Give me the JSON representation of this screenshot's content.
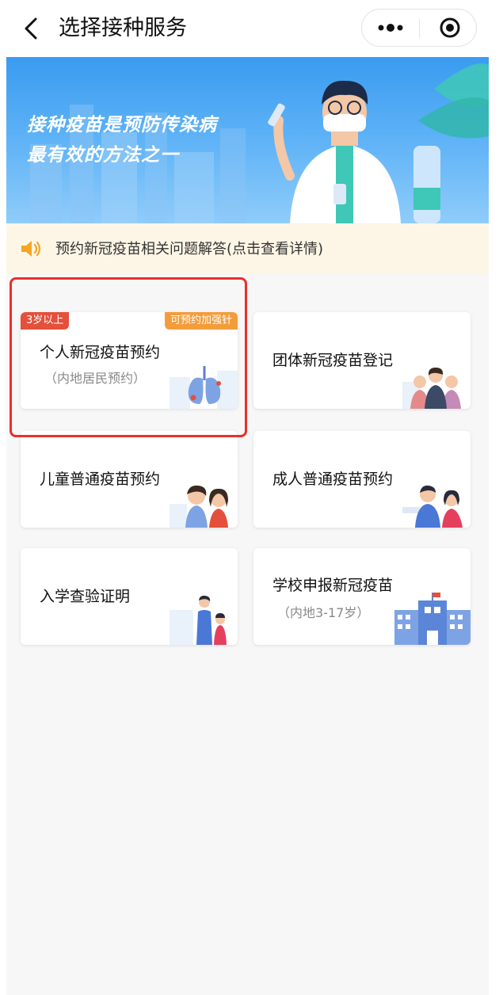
{
  "nav": {
    "title": "选择接种服务",
    "back_icon": "chevron-left-icon",
    "more_icon": "more-dots-icon",
    "close_icon": "target-close-icon"
  },
  "banner": {
    "line1": "接种疫苗是预防传染病",
    "line2": "最有效的方法之一"
  },
  "notice": {
    "icon": "speaker-icon",
    "text": "预约新冠疫苗相关问题解答(点击查看详情)"
  },
  "cards": [
    {
      "title": "个人新冠疫苗预约",
      "subtitle": "（内地居民预约）",
      "badge_left": "3岁以上",
      "badge_right": "可预约加强针",
      "illustration": "lungs-icon"
    },
    {
      "title": "团体新冠疫苗登记",
      "illustration": "group-people-icon"
    },
    {
      "title": "儿童普通疫苗预约",
      "illustration": "children-icon"
    },
    {
      "title": "成人普通疫苗预约",
      "illustration": "adults-icon"
    },
    {
      "title": "入学查验证明",
      "illustration": "mother-child-icon"
    },
    {
      "title": "学校申报新冠疫苗",
      "subtitle": "（内地3-17岁）",
      "illustration": "school-building-icon"
    }
  ],
  "colors": {
    "banner": "#4aa6f4",
    "notice_bg": "#fdf6e6",
    "badge_red": "#e4503b",
    "badge_orange": "#f39c3c",
    "highlight_border": "#e8302a"
  }
}
